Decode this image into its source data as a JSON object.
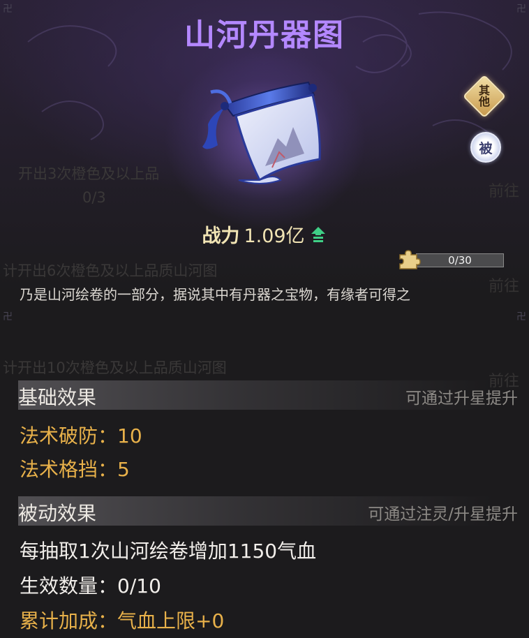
{
  "item": {
    "title": "山河丹器图",
    "power_label": "战力",
    "power_value": "1.09亿",
    "description": "乃是山河绘卷的一部分，据说其中有丹器之宝物，有缘者可得之"
  },
  "tags": {
    "other_line1": "其",
    "other_line2": "他",
    "passive": "被"
  },
  "fragments": {
    "progress_text": "0/30",
    "progress_fraction": 0
  },
  "base_effect": {
    "title": "基础效果",
    "hint": "可通过升星提升",
    "stats": [
      {
        "label": "法术破防：",
        "value": "10"
      },
      {
        "label": "法术格挡：",
        "value": "5"
      }
    ]
  },
  "passive_effect": {
    "title": "被动效果",
    "hint": "可通过注灵/升星提升",
    "effect_text": "每抽取1次山河绘卷增加1150气血",
    "count_label": "生效数量：",
    "count_value": "0/10",
    "total_label": "累计加成：",
    "total_value": "气血上限+0"
  },
  "background_list": {
    "rows": [
      "开出3次橙色及以上品",
      "0/3",
      "计开出6次橙色及以上品质山河图",
      "计开出10次橙色及以上品质山河图"
    ],
    "go_label": "前往"
  },
  "colors": {
    "title": "#b488ff",
    "gold": "#e8b14a",
    "power": "#f1e4b4",
    "arrow": "#3fcf86"
  }
}
